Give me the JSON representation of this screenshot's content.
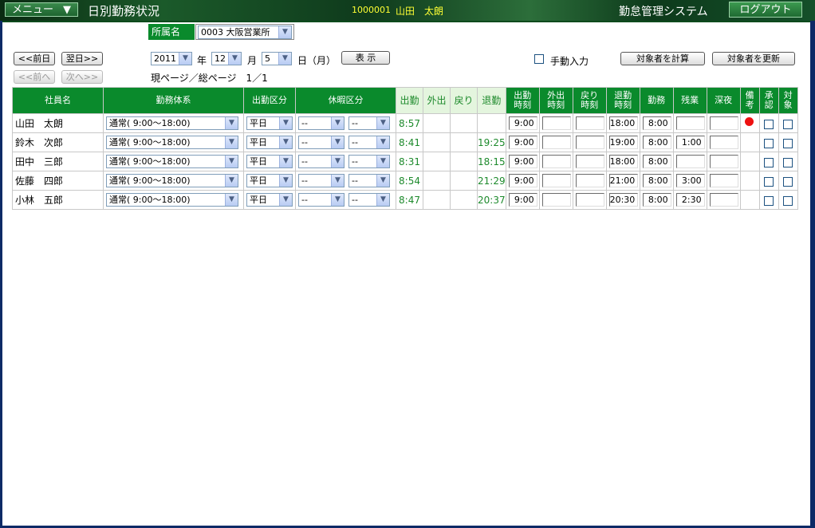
{
  "header": {
    "menu_label": "メニュー",
    "menu_caret": "▼",
    "page_title": "日別勤務状況",
    "user_id": "1000001",
    "user_name": "山田　太朗",
    "system_name": "勤怠管理システム",
    "logout_label": "ログアウト"
  },
  "department": {
    "label": "所属名",
    "value": "0003 大阪営業所"
  },
  "nav": {
    "prev_day": "<<前日",
    "next_day": "翌日>>",
    "prev_page": "<<前へ",
    "next_page": "次へ>>"
  },
  "date": {
    "year": "2011",
    "year_unit": "年",
    "month": "12",
    "month_unit": "月",
    "day": "5",
    "day_unit": "日（月）",
    "show_label": "表 示",
    "page_info": "現ページ／総ページ　1／1"
  },
  "actions": {
    "manual_input_label": "手動入力",
    "calculate_label": "対象者を計算",
    "update_label": "対象者を更新"
  },
  "table": {
    "headers": {
      "name": "社員名",
      "work_system": "勤務体系",
      "attendance_type": "出勤区分",
      "leave_type": "休暇区分",
      "in": "出勤",
      "out": "外出",
      "back": "戻り",
      "leave": "退勤",
      "in_time": "出勤時刻",
      "out_time": "外出時刻",
      "back_time": "戻り時刻",
      "leave_time": "退勤時刻",
      "work": "勤務",
      "overtime": "残業",
      "night": "深夜",
      "remarks": "備考",
      "approval": "承認",
      "target": "対象"
    },
    "rows": [
      {
        "name": "山田　太朗",
        "work_system": "通常( 9:00～18:00)",
        "attendance_type": "平日",
        "leave1": "--",
        "leave2": "--",
        "in": "8:57",
        "out": "",
        "back": "",
        "leave": "",
        "in_time": "9:00",
        "out_time": "",
        "back_time": "",
        "leave_time": "18:00",
        "work": "8:00",
        "overtime": "",
        "night": "",
        "remark_flag": true
      },
      {
        "name": "鈴木　次郎",
        "work_system": "通常( 9:00～18:00)",
        "attendance_type": "平日",
        "leave1": "--",
        "leave2": "--",
        "in": "8:41",
        "out": "",
        "back": "",
        "leave": "19:25",
        "in_time": "9:00",
        "out_time": "",
        "back_time": "",
        "leave_time": "19:00",
        "work": "8:00",
        "overtime": "1:00",
        "night": "",
        "remark_flag": false
      },
      {
        "name": "田中　三郎",
        "work_system": "通常( 9:00～18:00)",
        "attendance_type": "平日",
        "leave1": "--",
        "leave2": "--",
        "in": "8:31",
        "out": "",
        "back": "",
        "leave": "18:15",
        "in_time": "9:00",
        "out_time": "",
        "back_time": "",
        "leave_time": "18:00",
        "work": "8:00",
        "overtime": "",
        "night": "",
        "remark_flag": false
      },
      {
        "name": "佐藤　四郎",
        "work_system": "通常( 9:00～18:00)",
        "attendance_type": "平日",
        "leave1": "--",
        "leave2": "--",
        "in": "8:54",
        "out": "",
        "back": "",
        "leave": "21:29",
        "in_time": "9:00",
        "out_time": "",
        "back_time": "",
        "leave_time": "21:00",
        "work": "8:00",
        "overtime": "3:00",
        "night": "",
        "remark_flag": false
      },
      {
        "name": "小林　五郎",
        "work_system": "通常( 9:00～18:00)",
        "attendance_type": "平日",
        "leave1": "--",
        "leave2": "--",
        "in": "8:47",
        "out": "",
        "back": "",
        "leave": "20:37",
        "in_time": "9:00",
        "out_time": "",
        "back_time": "",
        "leave_time": "20:30",
        "work": "8:00",
        "overtime": "2:30",
        "night": "",
        "remark_flag": false
      }
    ]
  }
}
